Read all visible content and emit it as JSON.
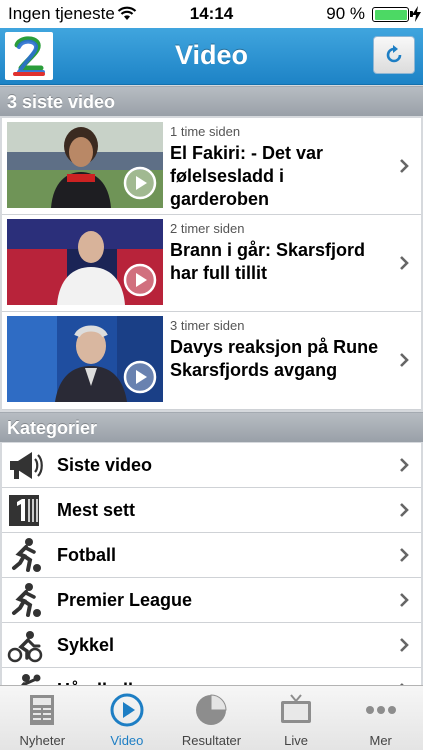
{
  "status_bar": {
    "carrier": "Ingen tjeneste",
    "time": "14:14",
    "battery": "90 %"
  },
  "nav": {
    "title": "Video",
    "logo_icon": "tv2-logo",
    "refresh_icon": "refresh-icon"
  },
  "sections": {
    "latest": "3 siste video",
    "categories": "Kategorier"
  },
  "videos": [
    {
      "time": "1 time siden",
      "title": "El Fakiri: - Det var følelsesladd i garderoben"
    },
    {
      "time": "2 timer siden",
      "title": "Brann i går: Skarsfjord har full tillit"
    },
    {
      "time": "3 timer siden",
      "title": "Davys reaksjon på Rune Skarsfjords avgang"
    }
  ],
  "categories": [
    {
      "label": "Siste video",
      "icon": "megaphone-icon"
    },
    {
      "label": "Mest sett",
      "icon": "number-one-icon"
    },
    {
      "label": "Fotball",
      "icon": "football-player-icon"
    },
    {
      "label": "Premier League",
      "icon": "football-player-icon"
    },
    {
      "label": "Sykkel",
      "icon": "cyclist-icon"
    },
    {
      "label": "Håndball",
      "icon": "handball-icon"
    }
  ],
  "tabs": [
    {
      "label": "Nyheter",
      "icon": "newspaper-icon",
      "active": false
    },
    {
      "label": "Video",
      "icon": "play-circle-icon",
      "active": true
    },
    {
      "label": "Resultater",
      "icon": "pie-chart-icon",
      "active": false
    },
    {
      "label": "Live",
      "icon": "tv-icon",
      "active": false
    },
    {
      "label": "Mer",
      "icon": "more-dots-icon",
      "active": false
    }
  ],
  "colors": {
    "nav_blue": "#2a91d1",
    "active_tab": "#1d7ec4",
    "section_grey": "#a3a9b0"
  }
}
